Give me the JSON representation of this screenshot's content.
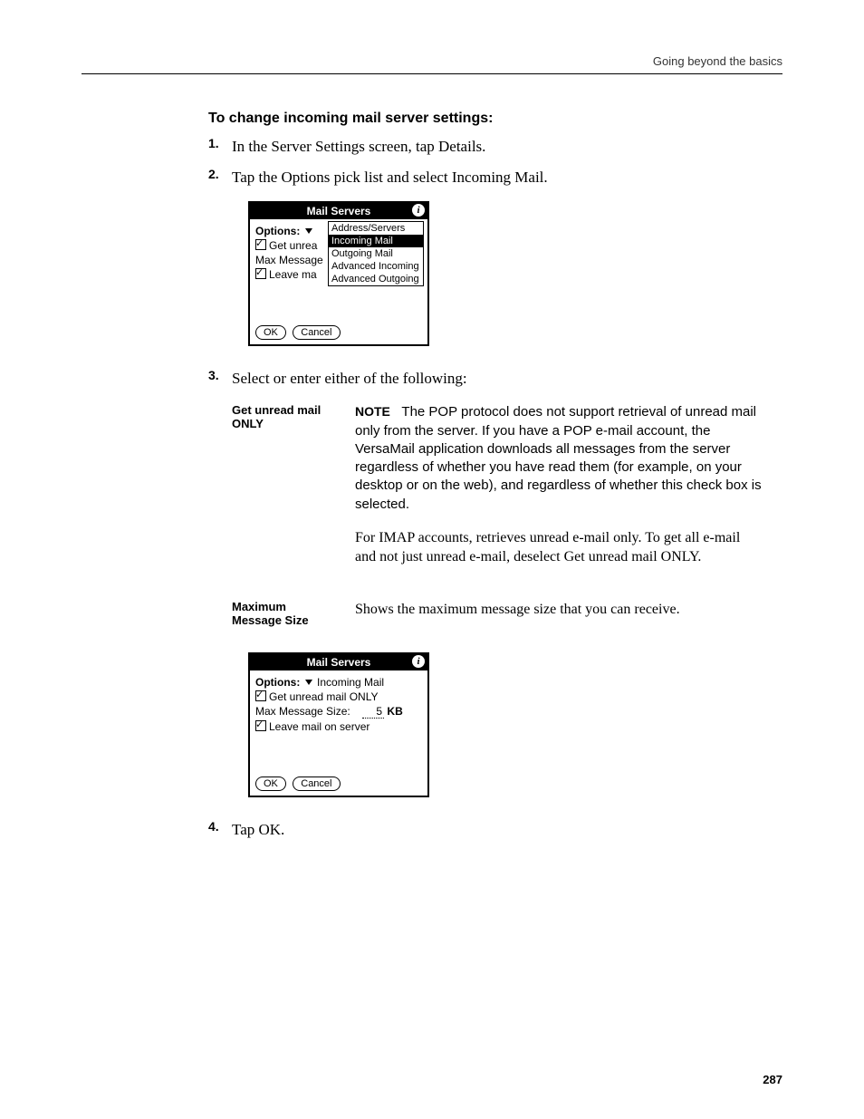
{
  "running_head": "Going beyond the basics",
  "section_title": "To change incoming mail server settings:",
  "steps": {
    "1": {
      "num": "1.",
      "text": "In the Server Settings screen, tap Details."
    },
    "2": {
      "num": "2.",
      "text": "Tap the Options pick list and select Incoming Mail."
    },
    "3": {
      "num": "3.",
      "text": "Select or enter either of the following:"
    },
    "4": {
      "num": "4.",
      "text": "Tap OK."
    }
  },
  "palm1": {
    "title": "Mail Servers",
    "options_label": "Options:",
    "row_get_unread": "Get unrea",
    "row_max": "Max Message",
    "row_leave": "Leave ma",
    "menu": {
      "item1": "Address/Servers",
      "item2": "Incoming Mail",
      "item3": "Outgoing Mail",
      "item4": "Advanced Incoming",
      "item5": "Advanced Outgoing"
    },
    "ok": "OK",
    "cancel": "Cancel"
  },
  "defs": {
    "get_unread": {
      "term": "Get unread mail ONLY",
      "note_label": "NOTE",
      "note_body": "The POP protocol does not support retrieval of unread mail only from the server. If you have a POP e-mail account, the VersaMail application downloads all messages from the server regardless of whether you have read them (for example, on your desktop or on the web), and regardless of whether this check box is selected.",
      "body2": "For IMAP accounts, retrieves unread e-mail only. To get all e-mail and not just unread e-mail, deselect Get unread mail ONLY."
    },
    "max_size": {
      "term": "Maximum Message Size",
      "body": "Shows the maximum message size that you can receive."
    }
  },
  "palm2": {
    "title": "Mail Servers",
    "options_label": "Options:",
    "options_value": "Incoming Mail",
    "row_get_unread": "Get unread mail ONLY",
    "row_max_label": "Max Message Size:",
    "row_max_value": "5",
    "row_max_unit": "KB",
    "row_leave": "Leave mail on server",
    "ok": "OK",
    "cancel": "Cancel"
  },
  "page_number": "287"
}
